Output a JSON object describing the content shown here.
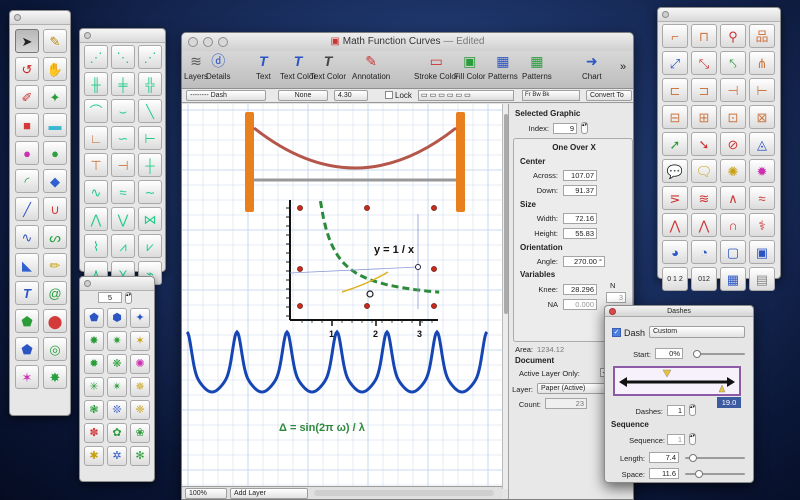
{
  "window": {
    "title": "Math  Function Curves",
    "edited": "— Edited"
  },
  "toolbar": {
    "items": [
      {
        "label": "Layers",
        "icon": "layers-icon",
        "glyph": "≋"
      },
      {
        "label": "Details",
        "icon": "details-icon",
        "glyph": "ⓓ"
      },
      {
        "label": "Text",
        "icon": "text-icon",
        "glyph": "T"
      },
      {
        "label": "Text Color",
        "icon": "text-color-icon",
        "glyph": "T"
      },
      {
        "label": "Text Color",
        "icon": "text-color-2-icon",
        "glyph": "T"
      },
      {
        "label": "Annotation",
        "icon": "annotation-icon",
        "glyph": "✎"
      },
      {
        "label": "Stroke Color",
        "icon": "stroke-color-icon",
        "glyph": "▭"
      },
      {
        "label": "Fill Color",
        "icon": "fill-color-icon",
        "glyph": "▣"
      },
      {
        "label": "Patterns",
        "icon": "patterns-icon",
        "glyph": "▦"
      },
      {
        "label": "Patterns",
        "icon": "patterns-2-icon",
        "glyph": "▦"
      },
      {
        "label": "Chart",
        "icon": "chart-icon",
        "glyph": "➜"
      }
    ],
    "overflow": "»"
  },
  "format_bar": {
    "dash_style": "--------  Dash",
    "arrow": "None",
    "stroke_width": "4.30",
    "lock_label": "Lock",
    "convert_to": "Convert To"
  },
  "canvas": {
    "axis_ticks": [
      "1",
      "2",
      "3"
    ],
    "curve_label": "y = 1 / x",
    "wave_label": "Δ = sin(2π ω) / λ"
  },
  "status": {
    "zoom": "100%",
    "add_layer": "Add Layer"
  },
  "inspector": {
    "selected_graphic_title": "Selected Graphic",
    "index_label": "Index:",
    "index_value": "9",
    "object_name": "One Over X",
    "center_title": "Center",
    "across_label": "Across:",
    "across_value": "107.07",
    "down_label": "Down:",
    "down_value": "91.37",
    "size_title": "Size",
    "width_label": "Width:",
    "width_value": "72.16",
    "height_label": "Height:",
    "height_value": "55.83",
    "orientation_title": "Orientation",
    "angle_label": "Angle:",
    "angle_value": "270.00 °",
    "variables_title": "Variables",
    "knee_label": "Knee:",
    "knee_value": "28.296",
    "na_label": "NA",
    "na_value": "0.000",
    "n_label": "N",
    "n_value": "3",
    "area_label": "Area:",
    "area_value": "1234.12",
    "document_title": "Document",
    "active_layer_label": "Active Layer Only:",
    "layer_label": "Layer:",
    "layer_value": "Paper (Active)",
    "count_label": "Count:",
    "count_value": "23"
  },
  "dashes": {
    "title": "Dashes",
    "dash_label": "Dash",
    "dash_preset": "Custom",
    "start_label": "Start:",
    "start_value": "0%",
    "preview_value": "19.0",
    "dashes_label": "Dashes:",
    "dashes_value": "1",
    "sequence_title": "Sequence",
    "sequence_label": "Sequence:",
    "sequence_value": "1",
    "length_label": "Length:",
    "length_value": "7.4",
    "space_label": "Space:",
    "space_value": "11.6"
  },
  "small_palette": {
    "count_value": "5"
  },
  "colors": {
    "accent_orange": "#e8801e",
    "curve_green": "#2d8a3a",
    "wave_blue": "#1646b4",
    "rope_red": "#b5564a"
  }
}
